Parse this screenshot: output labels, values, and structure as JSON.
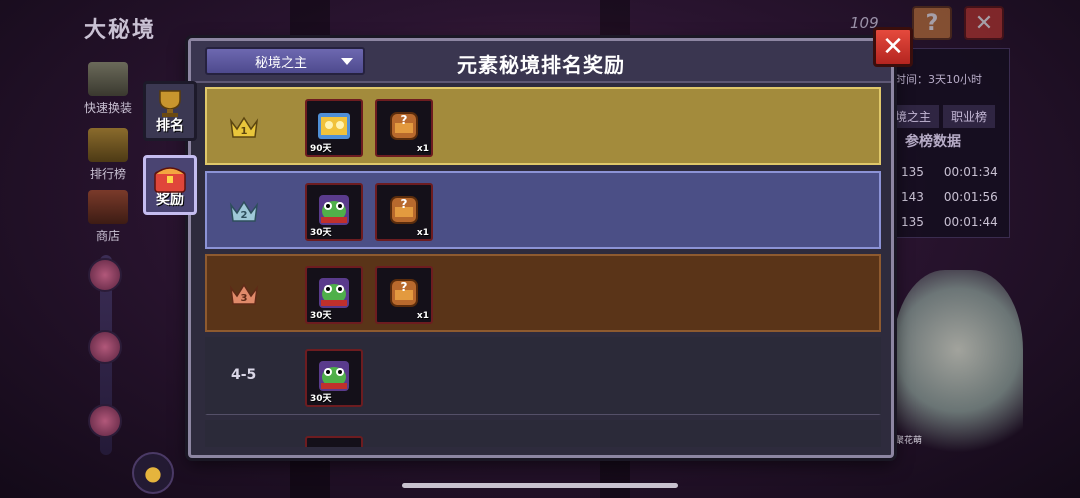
{
  "background": {
    "screen_title": "大秘境",
    "side_buttons": [
      {
        "label": "快速换装",
        "icon": "armor-swap-icon"
      },
      {
        "label": "排行榜",
        "icon": "trophy-icon"
      },
      {
        "label": "商店",
        "icon": "shop-icon"
      }
    ],
    "top_number": "109",
    "help_label": "?",
    "close_label": "✕",
    "right_panel": {
      "time_text": "时间：3天10小时",
      "tabs": [
        "境之主",
        "职业榜"
      ],
      "header": "参榜数据",
      "rows": [
        {
          "level": "135",
          "time": "00:01:34"
        },
        {
          "level": "143",
          "time": "00:01:56"
        },
        {
          "level": "135",
          "time": "00:01:44"
        }
      ],
      "caption": "聚花萌"
    }
  },
  "modal": {
    "title": "元素秘境排名奖励",
    "dropdown": {
      "selected": "秘境之主"
    },
    "close_label": "✕",
    "tabs": [
      {
        "label": "排名",
        "icon": "trophy-icon",
        "active": false
      },
      {
        "label": "奖励",
        "icon": "treasure-chest-icon",
        "active": true
      }
    ],
    "ranks": [
      {
        "rank": "1",
        "crown_color": "#e9c63b",
        "rewards": [
          {
            "icon": "gold-pet-icon",
            "qty": "90天",
            "qty_pos": "left"
          },
          {
            "icon": "mystery-chest-icon",
            "qty": "x1",
            "qty_pos": "right"
          }
        ]
      },
      {
        "rank": "2",
        "crown_color": "#9fc8d8",
        "rewards": [
          {
            "icon": "frog-costume-icon",
            "qty": "30天",
            "qty_pos": "left"
          },
          {
            "icon": "mystery-chest-icon",
            "qty": "x1",
            "qty_pos": "right"
          }
        ]
      },
      {
        "rank": "3",
        "crown_color": "#e08a6a",
        "rewards": [
          {
            "icon": "frog-costume-icon",
            "qty": "30天",
            "qty_pos": "left"
          },
          {
            "icon": "mystery-chest-icon",
            "qty": "x1",
            "qty_pos": "right"
          }
        ]
      },
      {
        "rank_text": "4-5",
        "rewards": [
          {
            "icon": "frog-costume-icon",
            "qty": "30天",
            "qty_pos": "left"
          }
        ]
      }
    ]
  }
}
